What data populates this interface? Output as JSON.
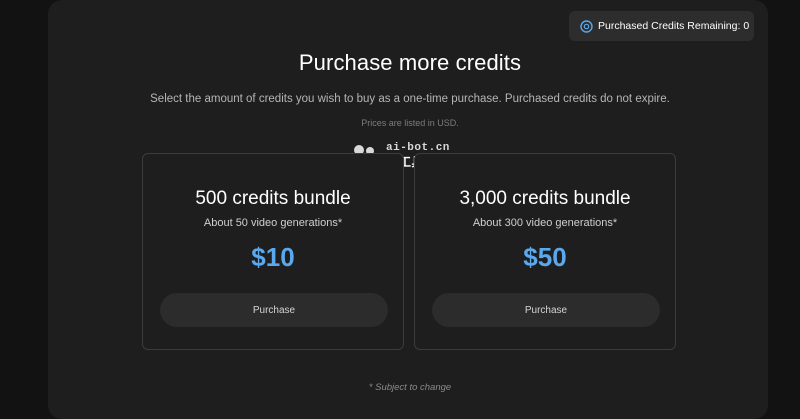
{
  "header": {
    "credits_label": "Purchased Credits Remaining: 0",
    "credits_icon": "credits-icon"
  },
  "main": {
    "title": "Purchase more credits",
    "subtitle": "Select the amount of credits you wish to buy as a one-time purchase. Purchased credits do not expire.",
    "currency_note": "Prices are listed in USD.",
    "footnote": "* Subject to change"
  },
  "watermark": {
    "line1": "ai-bot.cn",
    "line2": "AI工具集"
  },
  "bundles": [
    {
      "title": "500 credits bundle",
      "description": "About 50 video generations*",
      "price": "$10",
      "button_label": "Purchase"
    },
    {
      "title": "3,000 credits bundle",
      "description": "About 300 video generations*",
      "price": "$50",
      "button_label": "Purchase"
    }
  ],
  "colors": {
    "background": "#121212",
    "panel": "#1e1e1e",
    "accent_price": "#5aa8ee",
    "button": "#2c2c2c"
  }
}
